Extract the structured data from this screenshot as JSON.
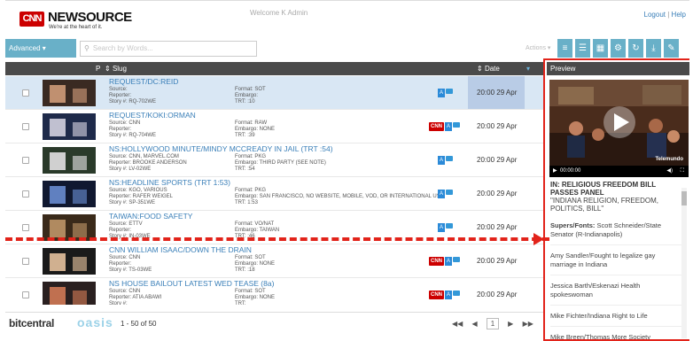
{
  "header": {
    "brand": "NEWSOURCE",
    "brand_logo": "CNN",
    "tagline": "We're at the heart of it.",
    "welcome": "Welcome K Admin",
    "logout": "Logout",
    "sep": "|",
    "help": "Help"
  },
  "toolbar": {
    "advanced_label": "Advanced ▾",
    "search_placeholder": "Search by Words...",
    "actions_label": "Actions ▾",
    "buttons": [
      "list-view-icon",
      "detail-view-icon",
      "grid-view-icon",
      "gear-icon",
      "refresh-icon",
      "download-icon",
      "edit-icon"
    ]
  },
  "table": {
    "columns": {
      "p": "P",
      "slug": "Slug",
      "date": "Date"
    },
    "rows": [
      {
        "slug": "REQUEST/DC:REID",
        "source": "Source:",
        "reporter": "Reporter:",
        "story": "Story #: RQ-702WE",
        "format": "Format: SOT",
        "embargo": "Embargo:",
        "trt": "TRT: :10",
        "date": "20:00 29 Apr 15",
        "cnn": false,
        "selected": true
      },
      {
        "slug": "REQUEST/KOKI:ORMAN",
        "source": "Source: CNN",
        "reporter": "Reporter:",
        "story": "Story #: RQ-704WE",
        "format": "Format: RAW",
        "embargo": "Embargo: NONE",
        "trt": "TRT: :39",
        "date": "20:00 29 Apr 15",
        "cnn": true,
        "selected": false
      },
      {
        "slug": "NS:HOLLYWOOD MINUTE/MINDY MCCREADY IN JAIL (TRT :54)",
        "source": "Source: CNN, MARVEL.COM",
        "reporter": "Reporter: BROOKE ANDERSON",
        "story": "Story #: LV-02WE",
        "format": "Format: PKG",
        "embargo": "Embargo: THIRD PARTY (SEE NOTE)",
        "trt": "TRT: :54",
        "date": "20:00 29 Apr 15",
        "cnn": false,
        "selected": false
      },
      {
        "slug": "NS:HEADLINE SPORTS (TRT 1:53)",
        "source": "Source: KGO, VARIOUS",
        "reporter": "Reporter: RAFER WEIGEL",
        "story": "Story #: SP-351WE",
        "format": "Format: PKG",
        "embargo": "Embargo: SAN FRANCISCO, NO WEBSITE, MOBILE, VOD, OR INTERNATIONAL USE",
        "trt": "TRT: 1:53",
        "date": "20:00 29 Apr 15",
        "cnn": false,
        "selected": false
      },
      {
        "slug": "TAIWAN:FOOD SAFETY",
        "source": "Source: ETTV",
        "reporter": "Reporter:",
        "story": "Story #: IN-03WE",
        "format": "Format: VO/NAT",
        "embargo": "Embargo: TAIWAN",
        "trt": "TRT: :46",
        "date": "20:00 29 Apr 15",
        "cnn": false,
        "selected": false
      },
      {
        "slug": "CNN WILLIAM ISAAC/DOWN THE DRAIN",
        "source": "Source: CNN",
        "reporter": "Reporter:",
        "story": "Story #: TS-03WE",
        "format": "Format: SOT",
        "embargo": "Embargo: NONE",
        "trt": "TRT: :18",
        "date": "20:00 29 Apr 15",
        "cnn": true,
        "selected": false
      },
      {
        "slug": "NS HOUSE BAILOUT LATEST WED TEASE (8a)",
        "source": "Source: CNN",
        "reporter": "Reporter: ATIA ABAWI",
        "story": "Story #:",
        "format": "Format: SOT",
        "embargo": "Embargo: NONE",
        "trt": "TRT:",
        "date": "20:00 29 Apr 15",
        "cnn": true,
        "selected": false
      }
    ]
  },
  "footer": {
    "brand": "bitcentral",
    "product": "oasis",
    "page_info": "1 - 50 of 50",
    "current_page": "1"
  },
  "preview": {
    "title": "Preview",
    "video_time": "00:00:00",
    "watermark": "Telemundo",
    "headline": "IN: RELIGIOUS FREEDOM BILL PASSES PANEL",
    "subhead": "\"INDIANA RELIGION, FREEDOM, POLITICS, BILL\"",
    "supers_label": "Supers/Fonts:",
    "supers_value": "Scott Schneider/State Senator (R-Indianapolis)",
    "items": [
      "Amy Sandler/Fought to legalize gay marriage in Indiana",
      "Jessica Barth/Eskenazi Health spokeswoman",
      "Mike Fichter/Indiana Right to Life",
      "Mike Breen/Thomas More Society"
    ]
  },
  "colors": {
    "accent": "#69b0c8",
    "highlight": "#e2231a",
    "link": "#3a7fb8"
  }
}
